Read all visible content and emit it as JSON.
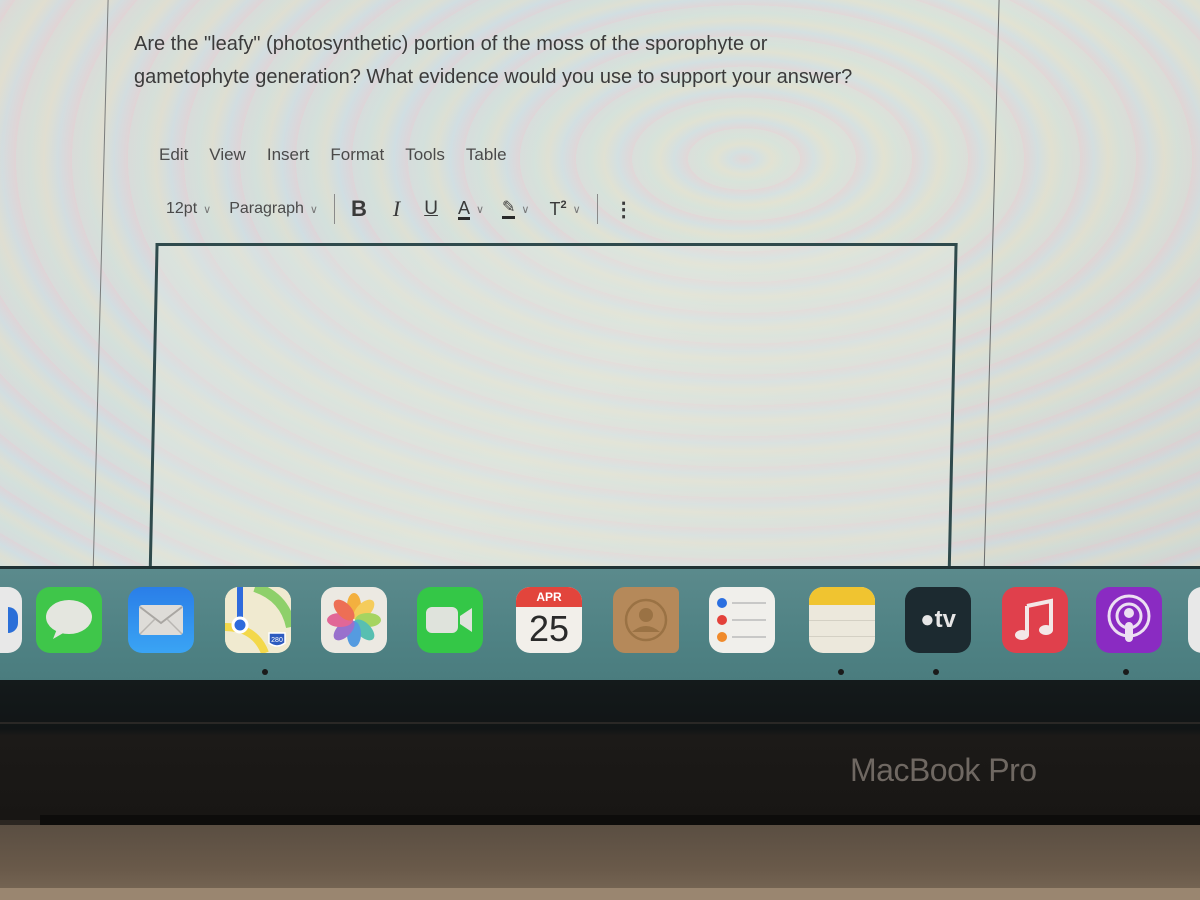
{
  "question": {
    "line1": "Are the \"leafy\" (photosynthetic) portion of the moss of the sporophyte or",
    "line2": "gametophyte generation? What evidence would you use to support your answer?"
  },
  "menubar": {
    "items": [
      "Edit",
      "View",
      "Insert",
      "Format",
      "Tools",
      "Table"
    ]
  },
  "toolbar": {
    "font_size": "12pt",
    "block_format": "Paragraph",
    "bold_label": "B",
    "italic_label": "I",
    "underline_label": "U",
    "text_color_label": "A",
    "highlight_label": "✎",
    "superscript_label": "T",
    "superscript_sup": "2",
    "more_label": "⋮",
    "chevron": "∨"
  },
  "editor": {
    "content": ""
  },
  "dock": {
    "apps": [
      {
        "name": "Safari (partially visible)",
        "icon": "safari-icon"
      },
      {
        "name": "Messages",
        "icon": "messages-icon",
        "color": "#3ecb4a"
      },
      {
        "name": "Mail",
        "icon": "mail-icon",
        "color": "#2f8ff2"
      },
      {
        "name": "Maps",
        "icon": "maps-icon",
        "badge": "280"
      },
      {
        "name": "Photos",
        "icon": "photos-icon"
      },
      {
        "name": "FaceTime",
        "icon": "facetime-icon",
        "color": "#35c948"
      },
      {
        "name": "Calendar",
        "icon": "calendar-icon",
        "month": "APR",
        "day": "25",
        "color": "#e2453c"
      },
      {
        "name": "Contacts",
        "icon": "contacts-icon",
        "color": "#b58a55"
      },
      {
        "name": "Reminders",
        "icon": "reminders-icon"
      },
      {
        "name": "Notes",
        "icon": "notes-icon",
        "color": "#f0c430"
      },
      {
        "name": "Apple TV",
        "icon": "tv-icon",
        "label": "tv",
        "color": "#1d2a30"
      },
      {
        "name": "Music",
        "icon": "music-icon",
        "color": "#e0404c"
      },
      {
        "name": "Podcasts",
        "icon": "podcasts-icon",
        "color": "#8a2bc2"
      },
      {
        "name": "Unknown (partially visible)",
        "icon": "app-icon"
      }
    ]
  },
  "device": {
    "brand_label": "MacBook Pro"
  }
}
